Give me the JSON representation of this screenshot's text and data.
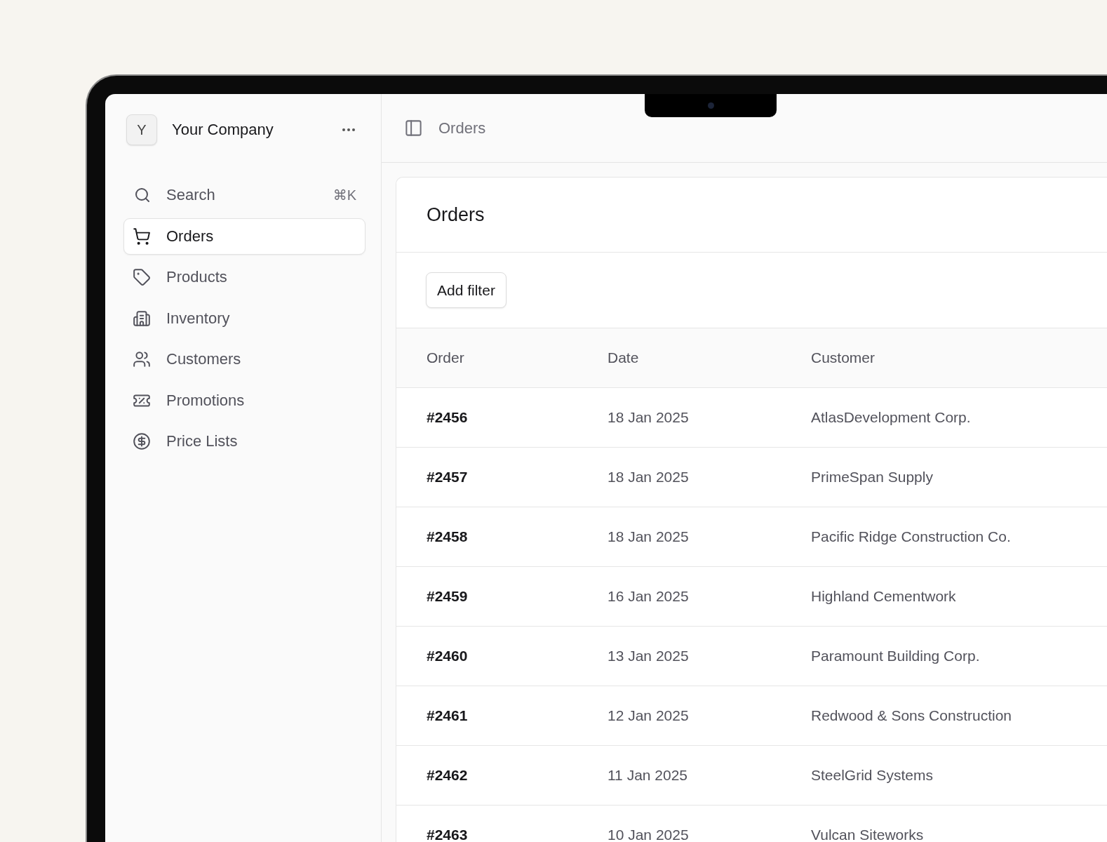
{
  "sidebar": {
    "company": {
      "initial": "Y",
      "name": "Your Company"
    },
    "search": {
      "label": "Search",
      "shortcut": "⌘K"
    },
    "items": [
      {
        "label": "Orders",
        "selected": true
      },
      {
        "label": "Products",
        "selected": false
      },
      {
        "label": "Inventory",
        "selected": false
      },
      {
        "label": "Customers",
        "selected": false
      },
      {
        "label": "Promotions",
        "selected": false
      },
      {
        "label": "Price Lists",
        "selected": false
      }
    ]
  },
  "topbar": {
    "title": "Orders"
  },
  "card": {
    "title": "Orders",
    "filter_button": "Add filter"
  },
  "table": {
    "columns": [
      "Order",
      "Date",
      "Customer"
    ],
    "rows": [
      [
        "#2456",
        "18 Jan 2025",
        "AtlasDevelopment Corp."
      ],
      [
        "#2457",
        "18 Jan 2025",
        "PrimeSpan Supply"
      ],
      [
        "#2458",
        "18 Jan 2025",
        "Pacific Ridge Construction Co."
      ],
      [
        "#2459",
        "16 Jan 2025",
        "Highland Cementwork"
      ],
      [
        "#2460",
        "13 Jan 2025",
        "Paramount Building Corp."
      ],
      [
        "#2461",
        "12 Jan 2025",
        "Redwood & Sons Construction"
      ],
      [
        "#2462",
        "11 Jan 2025",
        "SteelGrid Systems"
      ],
      [
        "#2463",
        "10 Jan 2025",
        "Vulcan Siteworks"
      ]
    ]
  }
}
